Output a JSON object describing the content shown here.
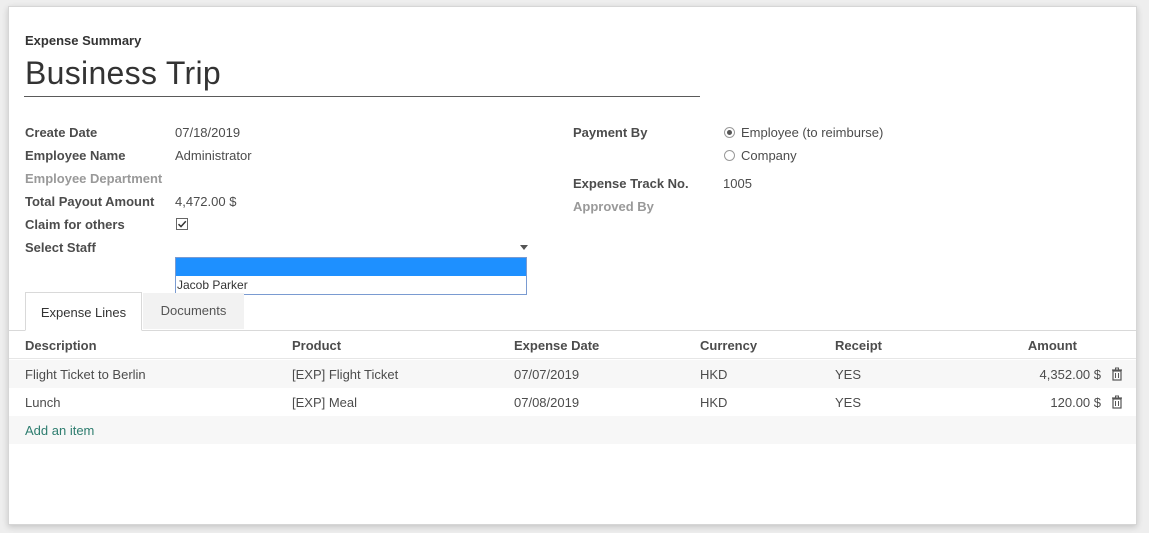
{
  "header": {
    "subtitle": "Expense Summary",
    "title": "Business Trip"
  },
  "left_fields": {
    "create_date": {
      "label": "Create Date",
      "value": "07/18/2019"
    },
    "employee_name": {
      "label": "Employee Name",
      "value": "Administrator"
    },
    "employee_department": {
      "label": "Employee Department",
      "value": ""
    },
    "total_payout": {
      "label": "Total Payout Amount",
      "value": "4,472.00 $"
    },
    "claim_for_others": {
      "label": "Claim for others",
      "checked": true
    },
    "select_staff": {
      "label": "Select Staff",
      "value": ""
    }
  },
  "dropdown": {
    "options": [
      "",
      "Jacob Parker"
    ],
    "highlighted_index": 0
  },
  "right_fields": {
    "payment_by": {
      "label": "Payment By",
      "options": [
        "Employee (to reimburse)",
        "Company"
      ],
      "selected": "Employee (to reimburse)"
    },
    "expense_track": {
      "label": "Expense Track No.",
      "value": "1005"
    },
    "approved_by": {
      "label": "Approved By",
      "value": ""
    }
  },
  "tabs": [
    {
      "label": "Expense Lines",
      "active": true
    },
    {
      "label": "Documents",
      "active": false
    }
  ],
  "table": {
    "columns": [
      "Description",
      "Product",
      "Expense Date",
      "Currency",
      "Receipt",
      "Amount"
    ],
    "rows": [
      {
        "description": "Flight Ticket to Berlin",
        "product": "[EXP] Flight Ticket",
        "date": "07/07/2019",
        "currency": "HKD",
        "receipt": "YES",
        "amount": "4,352.00 $"
      },
      {
        "description": "Lunch",
        "product": "[EXP] Meal",
        "date": "07/08/2019",
        "currency": "HKD",
        "receipt": "YES",
        "amount": "120.00 $"
      }
    ],
    "add_item": "Add an item"
  },
  "icons": {
    "delete": "trash-icon",
    "checkbox": "checkmark-icon",
    "caret": "caret-down-icon"
  },
  "colors": {
    "link": "#2e7d6f",
    "dropdown_highlight": "#1e90ff"
  }
}
